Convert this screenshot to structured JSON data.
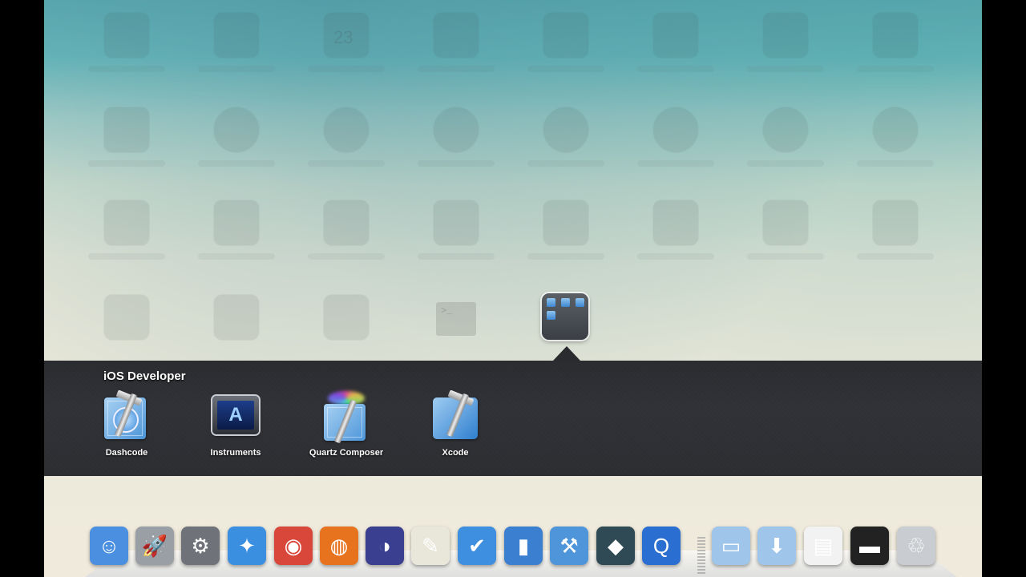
{
  "launchpad": {
    "ghost_calendar_day": "23",
    "ghost_terminal_prompt": ">_",
    "open_folder": {
      "title": "iOS Developer",
      "apps": [
        {
          "label": "Dashcode",
          "icon": "dashcode-icon"
        },
        {
          "label": "Instruments",
          "icon": "instruments-icon"
        },
        {
          "label": "Quartz Composer",
          "icon": "quartz-composer-icon"
        },
        {
          "label": "Xcode",
          "icon": "xcode-icon"
        }
      ]
    }
  },
  "dock": {
    "items": [
      {
        "name": "finder-icon",
        "glyph": "☺",
        "color": "#4a8fe0"
      },
      {
        "name": "launchpad-icon",
        "glyph": "🚀",
        "color": "#9a9fa6"
      },
      {
        "name": "system-preferences-icon",
        "glyph": "⚙",
        "color": "#6f7379"
      },
      {
        "name": "safari-icon",
        "glyph": "✦",
        "color": "#3a8fe0"
      },
      {
        "name": "chrome-icon",
        "glyph": "◉",
        "color": "#d9463a"
      },
      {
        "name": "firefox-icon",
        "glyph": "◍",
        "color": "#e8731e"
      },
      {
        "name": "eclipse-icon",
        "glyph": "◑",
        "color": "#3b3f8f"
      },
      {
        "name": "textedit-icon",
        "glyph": "✎",
        "color": "#e9e6da"
      },
      {
        "name": "todo-icon",
        "glyph": "✔",
        "color": "#3f8fe0"
      },
      {
        "name": "ios-simulator-icon",
        "glyph": "▮",
        "color": "#3b7fd0"
      },
      {
        "name": "xcode-icon",
        "glyph": "⚒",
        "color": "#4f95da"
      },
      {
        "name": "crystal-app-icon",
        "glyph": "◆",
        "color": "#2f4a55"
      },
      {
        "name": "quicktime-icon",
        "glyph": "Q",
        "color": "#2b6ed1"
      },
      {
        "name": "documents-folder-icon",
        "glyph": "▭",
        "color": "#9fc6ea"
      },
      {
        "name": "downloads-folder-icon",
        "glyph": "⬇",
        "color": "#9fc6ea"
      },
      {
        "name": "web-page-stack-icon",
        "glyph": "▤",
        "color": "#f2f2f2"
      },
      {
        "name": "screen-capture-icon",
        "glyph": "▬",
        "color": "#222"
      },
      {
        "name": "trash-icon",
        "glyph": "♲",
        "color": "#c9ccd0"
      }
    ]
  }
}
